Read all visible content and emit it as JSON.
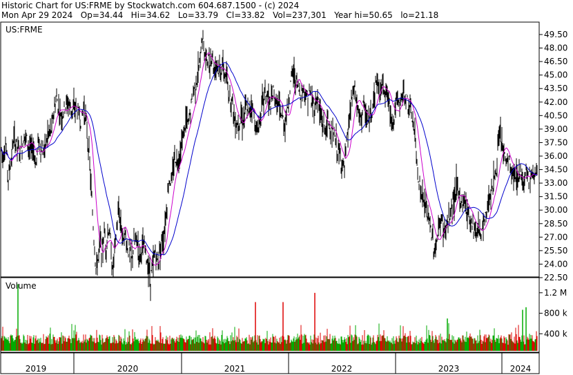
{
  "header": {
    "line1": "Historic Chart for US:FRME by Stockwatch.com 604.687.1500 - (c) 2024",
    "line2": "Mon Apr 29 2024   Op=34.44   Hi=34.62   Lo=33.79   Cl=33.82   Vol=237,301   Year hi=50.65   lo=21.18"
  },
  "chart_data": [
    {
      "type": "line",
      "symbol": "US:FRME",
      "title": "US:FRME",
      "ylim": [
        21.18,
        50.65
      ],
      "y_ticks": [
        "49.50",
        "48.00",
        "46.50",
        "45.00",
        "43.50",
        "42.00",
        "40.50",
        "39.00",
        "37.50",
        "36.00",
        "34.50",
        "33.00",
        "31.50",
        "30.00",
        "28.50",
        "27.00",
        "25.50",
        "24.00",
        "22.50"
      ],
      "grid": false,
      "x_years": [
        "2019",
        "2020",
        "2021",
        "2022",
        "2023",
        "2024"
      ],
      "colors": {
        "price": "#000000",
        "ma_short": "#cc00cc",
        "ma_long": "#0000cc"
      },
      "series": [
        {
          "points": [
            [
              0,
              37.5
            ],
            [
              4,
              36.0
            ],
            [
              8,
              37.5
            ],
            [
              12,
              33.5
            ],
            [
              16,
              35.5
            ],
            [
              20,
              38.0
            ],
            [
              25,
              37.0
            ],
            [
              30,
              36.0
            ],
            [
              35,
              38.5
            ],
            [
              40,
              37.5
            ],
            [
              44,
              36.5
            ],
            [
              48,
              37.0
            ],
            [
              52,
              35.0
            ],
            [
              56,
              38.0
            ],
            [
              60,
              36.5
            ],
            [
              65,
              37.0
            ],
            [
              70,
              38.5
            ],
            [
              75,
              39.0
            ],
            [
              78,
              41.0
            ],
            [
              82,
              42.5
            ],
            [
              86,
              41.0
            ],
            [
              90,
              40.5
            ],
            [
              94,
              41.5
            ],
            [
              98,
              42.0
            ],
            [
              102,
              41.5
            ],
            [
              106,
              41.0
            ],
            [
              110,
              41.5
            ],
            [
              114,
              40.5
            ],
            [
              118,
              40.0
            ],
            [
              121,
              41.5
            ],
            [
              124,
              40.5
            ],
            [
              127,
              38.0
            ],
            [
              130,
              35.0
            ],
            [
              133,
              31.0
            ],
            [
              136,
              27.0
            ],
            [
              139,
              23.5
            ],
            [
              142,
              24.5
            ],
            [
              145,
              26.5
            ],
            [
              148,
              25.5
            ],
            [
              151,
              27.5
            ],
            [
              154,
              26.0
            ],
            [
              157,
              28.0
            ],
            [
              160,
              26.5
            ],
            [
              163,
              23.0
            ],
            [
              166,
              25.5
            ],
            [
              169,
              28.0
            ],
            [
              172,
              30.0
            ],
            [
              175,
              28.5
            ],
            [
              178,
              27.0
            ],
            [
              181,
              27.5
            ],
            [
              184,
              26.0
            ],
            [
              187,
              25.5
            ],
            [
              190,
              24.5
            ],
            [
              194,
              26.0
            ],
            [
              198,
              27.0
            ],
            [
              202,
              25.0
            ],
            [
              206,
              26.0
            ],
            [
              210,
              25.5
            ],
            [
              214,
              24.0
            ],
            [
              218,
              22.5
            ],
            [
              221,
              23.5
            ],
            [
              225,
              25.5
            ],
            [
              229,
              24.0
            ],
            [
              233,
              26.5
            ],
            [
              237,
              27.0
            ],
            [
              241,
              30.0
            ],
            [
              245,
              33.5
            ],
            [
              249,
              33.0
            ],
            [
              253,
              36.0
            ],
            [
              257,
              35.5
            ],
            [
              261,
              36.5
            ],
            [
              265,
              38.0
            ],
            [
              269,
              40.0
            ],
            [
              273,
              39.5
            ],
            [
              277,
              41.5
            ],
            [
              281,
              43.5
            ],
            [
              285,
              44.5
            ],
            [
              289,
              46.0
            ],
            [
              292,
              49.0
            ],
            [
              295,
              48.5
            ],
            [
              298,
              46.5
            ],
            [
              301,
              47.0
            ],
            [
              304,
              46.0
            ],
            [
              307,
              47.5
            ],
            [
              310,
              45.5
            ],
            [
              313,
              46.5
            ],
            [
              316,
              46.0
            ],
            [
              319,
              45.0
            ],
            [
              322,
              46.5
            ],
            [
              325,
              45.0
            ],
            [
              328,
              44.5
            ],
            [
              331,
              43.0
            ],
            [
              334,
              42.5
            ],
            [
              337,
              42.0
            ],
            [
              340,
              40.0
            ],
            [
              344,
              39.5
            ],
            [
              348,
              40.5
            ],
            [
              352,
              40.0
            ],
            [
              356,
              41.5
            ],
            [
              360,
              40.5
            ],
            [
              364,
              42.0
            ],
            [
              368,
              40.5
            ],
            [
              372,
              38.5
            ],
            [
              376,
              40.0
            ],
            [
              380,
              42.0
            ],
            [
              384,
              43.0
            ],
            [
              388,
              42.5
            ],
            [
              392,
              41.5
            ],
            [
              396,
              43.0
            ],
            [
              400,
              42.0
            ],
            [
              404,
              41.5
            ],
            [
              408,
              40.5
            ],
            [
              412,
              39.5
            ],
            [
              416,
              41.0
            ],
            [
              420,
              43.5
            ],
            [
              424,
              45.5
            ],
            [
              428,
              44.5
            ],
            [
              432,
              43.5
            ],
            [
              436,
              43.0
            ],
            [
              440,
              43.5
            ],
            [
              444,
              42.5
            ],
            [
              448,
              43.0
            ],
            [
              452,
              42.0
            ],
            [
              456,
              41.5
            ],
            [
              460,
              42.5
            ],
            [
              464,
              40.5
            ],
            [
              468,
              39.5
            ],
            [
              472,
              39.0
            ],
            [
              476,
              40.0
            ],
            [
              480,
              38.5
            ],
            [
              484,
              38.0
            ],
            [
              488,
              37.0
            ],
            [
              492,
              36.0
            ],
            [
              496,
              35.0
            ],
            [
              499,
              34.5
            ],
            [
              502,
              37.0
            ],
            [
              506,
              40.0
            ],
            [
              510,
              42.5
            ],
            [
              514,
              43.5
            ],
            [
              518,
              41.0
            ],
            [
              522,
              40.0
            ],
            [
              526,
              41.5
            ],
            [
              530,
              40.5
            ],
            [
              534,
              39.5
            ],
            [
              538,
              41.0
            ],
            [
              542,
              43.0
            ],
            [
              546,
              44.5
            ],
            [
              550,
              43.0
            ],
            [
              554,
              44.0
            ],
            [
              558,
              43.5
            ],
            [
              562,
              42.5
            ],
            [
              566,
              40.5
            ],
            [
              570,
              40.0
            ],
            [
              574,
              42.0
            ],
            [
              578,
              41.5
            ],
            [
              582,
              42.5
            ],
            [
              586,
              43.0
            ],
            [
              590,
              42.0
            ],
            [
              594,
              41.0
            ],
            [
              598,
              40.0
            ],
            [
              601,
              38.0
            ],
            [
              604,
              35.5
            ],
            [
              607,
              33.0
            ],
            [
              610,
              32.0
            ],
            [
              613,
              31.0
            ],
            [
              616,
              30.5
            ],
            [
              619,
              29.5
            ],
            [
              622,
              28.5
            ],
            [
              625,
              27.5
            ],
            [
              628,
              26.0
            ],
            [
              631,
              25.5
            ],
            [
              634,
              27.0
            ],
            [
              637,
              28.5
            ],
            [
              640,
              29.0
            ],
            [
              643,
              27.5
            ],
            [
              646,
              28.0
            ],
            [
              649,
              28.5
            ],
            [
              652,
              29.5
            ],
            [
              655,
              30.5
            ],
            [
              658,
              31.5
            ],
            [
              661,
              32.5
            ],
            [
              664,
              32.0
            ],
            [
              667,
              31.0
            ],
            [
              670,
              30.5
            ],
            [
              673,
              31.5
            ],
            [
              676,
              30.0
            ],
            [
              679,
              29.5
            ],
            [
              682,
              29.0
            ],
            [
              685,
              28.5
            ],
            [
              688,
              28.0
            ],
            [
              691,
              27.5
            ],
            [
              694,
              28.5
            ],
            [
              697,
              27.0
            ],
            [
              700,
              28.0
            ],
            [
              703,
              29.0
            ],
            [
              706,
              30.5
            ],
            [
              709,
              31.5
            ],
            [
              712,
              32.5
            ],
            [
              715,
              33.0
            ],
            [
              718,
              34.0
            ],
            [
              721,
              36.5
            ],
            [
              724,
              38.0
            ],
            [
              727,
              37.5
            ],
            [
              730,
              36.0
            ],
            [
              733,
              35.0
            ],
            [
              736,
              36.0
            ],
            [
              739,
              34.5
            ],
            [
              742,
              34.0
            ],
            [
              745,
              33.5
            ],
            [
              748,
              34.0
            ],
            [
              751,
              33.5
            ],
            [
              754,
              34.5
            ],
            [
              757,
              33.0
            ],
            [
              760,
              34.0
            ],
            [
              763,
              34.5
            ],
            [
              766,
              33.5
            ],
            [
              769,
              34.0
            ],
            [
              772,
              33.5
            ],
            [
              775,
              34.5
            ],
            [
              778,
              33.82
            ]
          ]
        }
      ]
    },
    {
      "type": "bar",
      "title": "Volume",
      "y_ticks": [
        "1.2 M",
        "800 k",
        "400 k"
      ],
      "ylim": [
        0,
        1400000
      ],
      "colors": {
        "up": "#00aa00",
        "down": "#dd0000"
      },
      "values_note_units": "shares",
      "spikes": [
        {
          "x": 26,
          "value": 1300000,
          "dir": "up"
        },
        {
          "x": 370,
          "value": 950000,
          "dir": "down"
        },
        {
          "x": 410,
          "value": 950000,
          "dir": "down"
        },
        {
          "x": 456,
          "value": 1130000,
          "dir": "down"
        },
        {
          "x": 648,
          "value": 630000,
          "dir": "up"
        },
        {
          "x": 757,
          "value": 800000,
          "dir": "up"
        },
        {
          "x": 762,
          "value": 850000,
          "dir": "up"
        }
      ]
    }
  ]
}
